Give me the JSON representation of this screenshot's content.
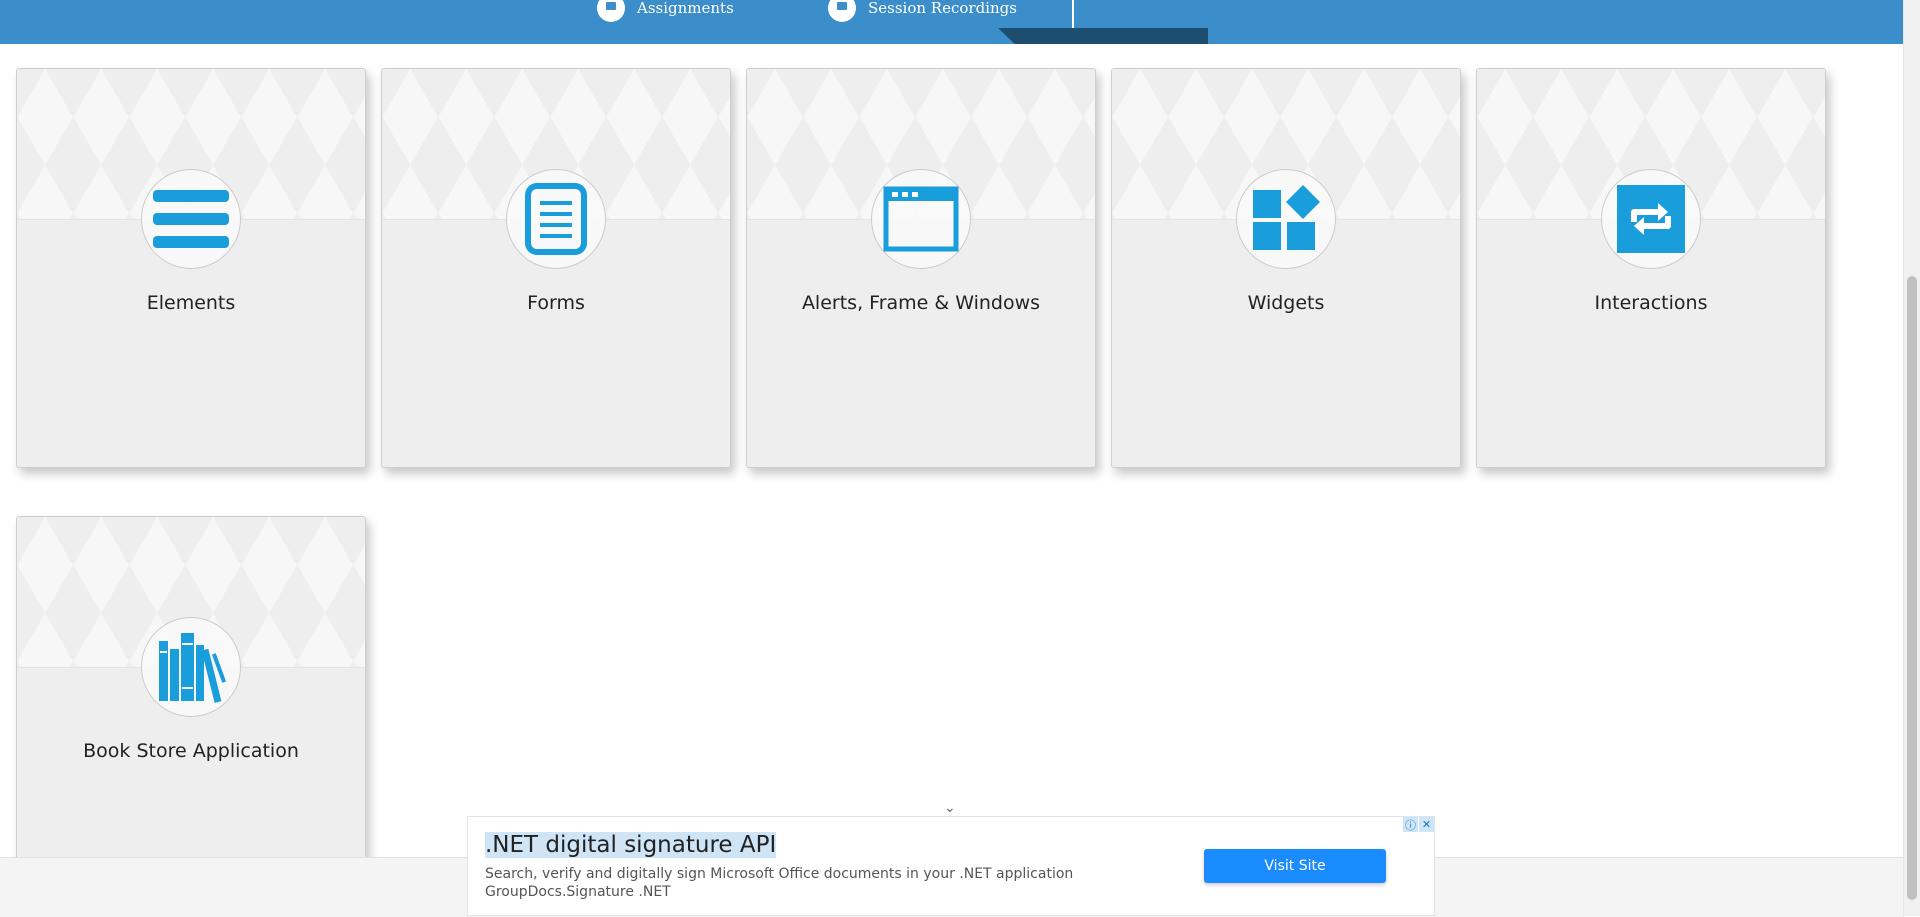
{
  "banner": {
    "links": [
      {
        "label": "Assignments"
      },
      {
        "label": "Session Recordings"
      }
    ]
  },
  "cards": [
    {
      "title": "Elements",
      "icon": "hamburger-icon"
    },
    {
      "title": "Forms",
      "icon": "document-icon"
    },
    {
      "title": "Alerts, Frame & Windows",
      "icon": "browser-window-icon"
    },
    {
      "title": "Widgets",
      "icon": "widgets-icon"
    },
    {
      "title": "Interactions",
      "icon": "repeat-arrows-icon"
    },
    {
      "title": "Book Store Application",
      "icon": "books-icon"
    }
  ],
  "ad": {
    "title": ".NET digital signature API",
    "description": "Search, verify and digitally sign Microsoft Office documents in your .NET application",
    "sponsor": "GroupDocs.Signature .NET",
    "cta": "Visit Site"
  },
  "colors": {
    "banner": "#3b8ec9",
    "icon": "#1a9ddb",
    "card": "#eeeeee",
    "cta": "#1a8cff"
  }
}
